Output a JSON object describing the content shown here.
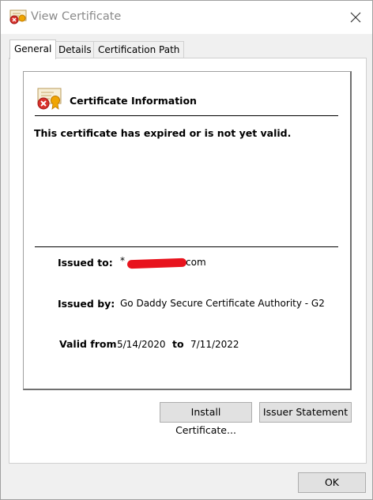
{
  "window": {
    "title": "View Certificate"
  },
  "tabs": [
    {
      "label": "General",
      "active": true
    },
    {
      "label": "Details",
      "active": false
    },
    {
      "label": "Certification Path",
      "active": false
    }
  ],
  "general": {
    "info_title": "Certificate Information",
    "status_message": "This certificate has expired or is not yet valid.",
    "issued_to_label": "Issued to:",
    "issued_to_prefix": "*",
    "issued_to_suffix": "com",
    "issued_by_label": "Issued by:",
    "issued_by_value": "Go Daddy Secure Certificate Authority - G2",
    "valid_from_label": "Valid from",
    "valid_from_value": "5/14/2020",
    "to_label": "to",
    "valid_to_value": "7/11/2022",
    "install_button": "Install Certificate...",
    "issuer_statement_button": "Issuer Statement"
  },
  "footer": {
    "ok_button": "OK"
  },
  "colors": {
    "redaction": "#e8131d",
    "error_badge": "#d9322b"
  }
}
